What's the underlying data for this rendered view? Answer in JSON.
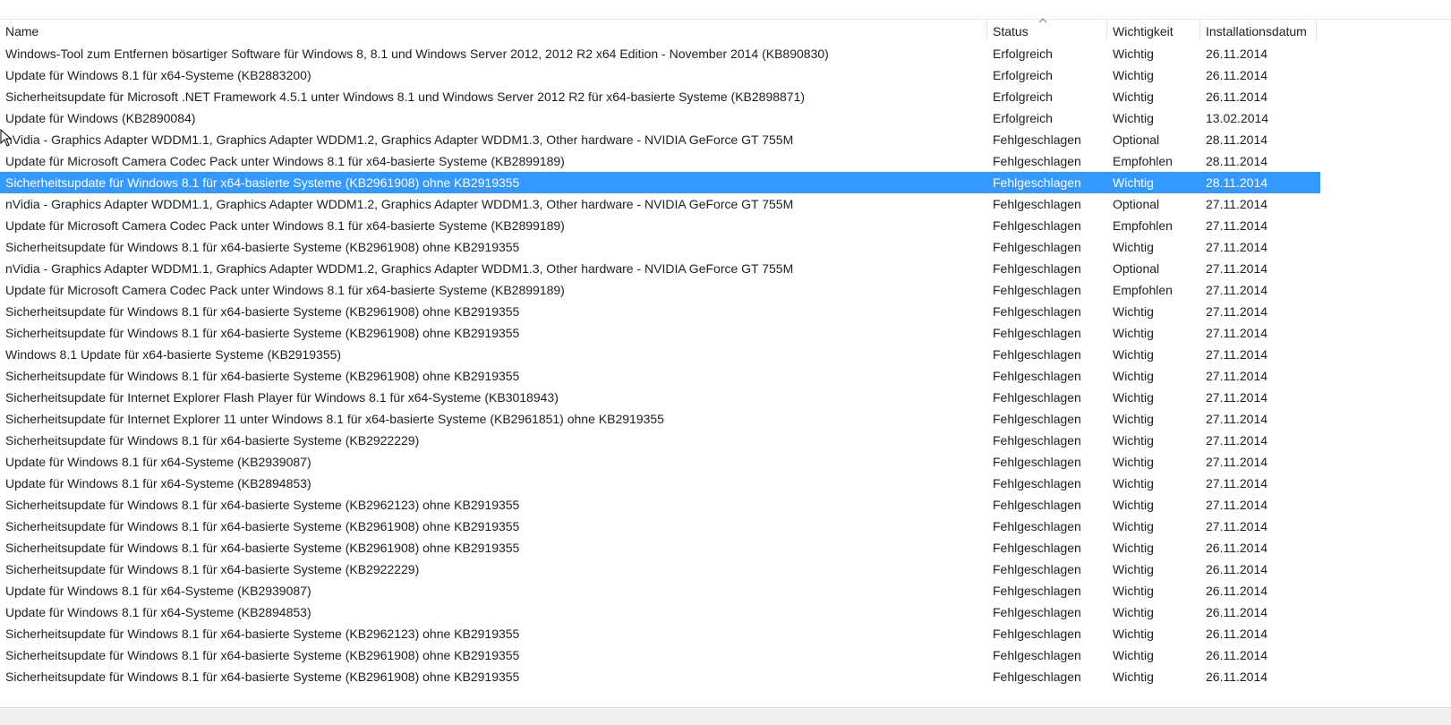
{
  "columns": {
    "name": "Name",
    "status": "Status",
    "importance": "Wichtigkeit",
    "date": "Installationsdatum"
  },
  "sort": {
    "column": "status",
    "direction": "ascending",
    "icon": "sort-up-arrow-icon"
  },
  "colors": {
    "selection": "#3399ff",
    "selection_text": "#ffffff",
    "text": "#1e1e1e",
    "divider": "#e5e5e5"
  },
  "selected_index": 6,
  "rows": [
    {
      "name": "Windows-Tool zum Entfernen bösartiger Software für Windows 8, 8.1 und Windows Server 2012, 2012 R2 x64 Edition - November 2014 (KB890830)",
      "status": "Erfolgreich",
      "importance": "Wichtig",
      "date": "26.11.2014"
    },
    {
      "name": "Update für Windows 8.1 für x64-Systeme (KB2883200)",
      "status": "Erfolgreich",
      "importance": "Wichtig",
      "date": "26.11.2014"
    },
    {
      "name": "Sicherheitsupdate für Microsoft .NET Framework 4.5.1 unter Windows 8.1 und Windows Server 2012 R2 für x64-basierte Systeme (KB2898871)",
      "status": "Erfolgreich",
      "importance": "Wichtig",
      "date": "26.11.2014"
    },
    {
      "name": "Update für Windows (KB2890084)",
      "status": "Erfolgreich",
      "importance": "Wichtig",
      "date": "13.02.2014"
    },
    {
      "name": "nVidia - Graphics Adapter WDDM1.1, Graphics Adapter WDDM1.2, Graphics Adapter WDDM1.3, Other hardware - NVIDIA GeForce GT 755M",
      "status": "Fehlgeschlagen",
      "importance": "Optional",
      "date": "28.11.2014"
    },
    {
      "name": "Update für Microsoft Camera Codec Pack unter Windows 8.1 für x64-basierte Systeme (KB2899189)",
      "status": "Fehlgeschlagen",
      "importance": "Empfohlen",
      "date": "28.11.2014"
    },
    {
      "name": "Sicherheitsupdate für Windows 8.1 für x64-basierte Systeme (KB2961908) ohne KB2919355",
      "status": "Fehlgeschlagen",
      "importance": "Wichtig",
      "date": "28.11.2014"
    },
    {
      "name": "nVidia - Graphics Adapter WDDM1.1, Graphics Adapter WDDM1.2, Graphics Adapter WDDM1.3, Other hardware - NVIDIA GeForce GT 755M",
      "status": "Fehlgeschlagen",
      "importance": "Optional",
      "date": "27.11.2014"
    },
    {
      "name": "Update für Microsoft Camera Codec Pack unter Windows 8.1 für x64-basierte Systeme (KB2899189)",
      "status": "Fehlgeschlagen",
      "importance": "Empfohlen",
      "date": "27.11.2014"
    },
    {
      "name": "Sicherheitsupdate für Windows 8.1 für x64-basierte Systeme (KB2961908) ohne KB2919355",
      "status": "Fehlgeschlagen",
      "importance": "Wichtig",
      "date": "27.11.2014"
    },
    {
      "name": "nVidia - Graphics Adapter WDDM1.1, Graphics Adapter WDDM1.2, Graphics Adapter WDDM1.3, Other hardware - NVIDIA GeForce GT 755M",
      "status": "Fehlgeschlagen",
      "importance": "Optional",
      "date": "27.11.2014"
    },
    {
      "name": "Update für Microsoft Camera Codec Pack unter Windows 8.1 für x64-basierte Systeme (KB2899189)",
      "status": "Fehlgeschlagen",
      "importance": "Empfohlen",
      "date": "27.11.2014"
    },
    {
      "name": "Sicherheitsupdate für Windows 8.1 für x64-basierte Systeme (KB2961908) ohne KB2919355",
      "status": "Fehlgeschlagen",
      "importance": "Wichtig",
      "date": "27.11.2014"
    },
    {
      "name": "Sicherheitsupdate für Windows 8.1 für x64-basierte Systeme (KB2961908) ohne KB2919355",
      "status": "Fehlgeschlagen",
      "importance": "Wichtig",
      "date": "27.11.2014"
    },
    {
      "name": "Windows 8.1 Update für x64-basierte Systeme (KB2919355)",
      "status": "Fehlgeschlagen",
      "importance": "Wichtig",
      "date": "27.11.2014"
    },
    {
      "name": "Sicherheitsupdate für Windows 8.1 für x64-basierte Systeme (KB2961908) ohne KB2919355",
      "status": "Fehlgeschlagen",
      "importance": "Wichtig",
      "date": "27.11.2014"
    },
    {
      "name": "Sicherheitsupdate für Internet Explorer Flash Player für Windows 8.1 für x64-Systeme (KB3018943)",
      "status": "Fehlgeschlagen",
      "importance": "Wichtig",
      "date": "27.11.2014"
    },
    {
      "name": "Sicherheitsupdate für Internet Explorer 11 unter Windows 8.1 für x64-basierte Systeme (KB2961851) ohne KB2919355",
      "status": "Fehlgeschlagen",
      "importance": "Wichtig",
      "date": "27.11.2014"
    },
    {
      "name": "Sicherheitsupdate für Windows 8.1 für x64-basierte Systeme (KB2922229)",
      "status": "Fehlgeschlagen",
      "importance": "Wichtig",
      "date": "27.11.2014"
    },
    {
      "name": "Update für Windows 8.1 für x64-Systeme (KB2939087)",
      "status": "Fehlgeschlagen",
      "importance": "Wichtig",
      "date": "27.11.2014"
    },
    {
      "name": "Update für Windows 8.1 für x64-Systeme (KB2894853)",
      "status": "Fehlgeschlagen",
      "importance": "Wichtig",
      "date": "27.11.2014"
    },
    {
      "name": "Sicherheitsupdate für Windows 8.1 für x64-basierte Systeme (KB2962123) ohne KB2919355",
      "status": "Fehlgeschlagen",
      "importance": "Wichtig",
      "date": "27.11.2014"
    },
    {
      "name": "Sicherheitsupdate für Windows 8.1 für x64-basierte Systeme (KB2961908) ohne KB2919355",
      "status": "Fehlgeschlagen",
      "importance": "Wichtig",
      "date": "27.11.2014"
    },
    {
      "name": "Sicherheitsupdate für Windows 8.1 für x64-basierte Systeme (KB2961908) ohne KB2919355",
      "status": "Fehlgeschlagen",
      "importance": "Wichtig",
      "date": "26.11.2014"
    },
    {
      "name": "Sicherheitsupdate für Windows 8.1 für x64-basierte Systeme (KB2922229)",
      "status": "Fehlgeschlagen",
      "importance": "Wichtig",
      "date": "26.11.2014"
    },
    {
      "name": "Update für Windows 8.1 für x64-Systeme (KB2939087)",
      "status": "Fehlgeschlagen",
      "importance": "Wichtig",
      "date": "26.11.2014"
    },
    {
      "name": "Update für Windows 8.1 für x64-Systeme (KB2894853)",
      "status": "Fehlgeschlagen",
      "importance": "Wichtig",
      "date": "26.11.2014"
    },
    {
      "name": "Sicherheitsupdate für Windows 8.1 für x64-basierte Systeme (KB2962123) ohne KB2919355",
      "status": "Fehlgeschlagen",
      "importance": "Wichtig",
      "date": "26.11.2014"
    },
    {
      "name": "Sicherheitsupdate für Windows 8.1 für x64-basierte Systeme (KB2961908) ohne KB2919355",
      "status": "Fehlgeschlagen",
      "importance": "Wichtig",
      "date": "26.11.2014"
    },
    {
      "name": "Sicherheitsupdate für Windows 8.1 für x64-basierte Systeme (KB2961908) ohne KB2919355",
      "status": "Fehlgeschlagen",
      "importance": "Wichtig",
      "date": "26.11.2014"
    }
  ]
}
